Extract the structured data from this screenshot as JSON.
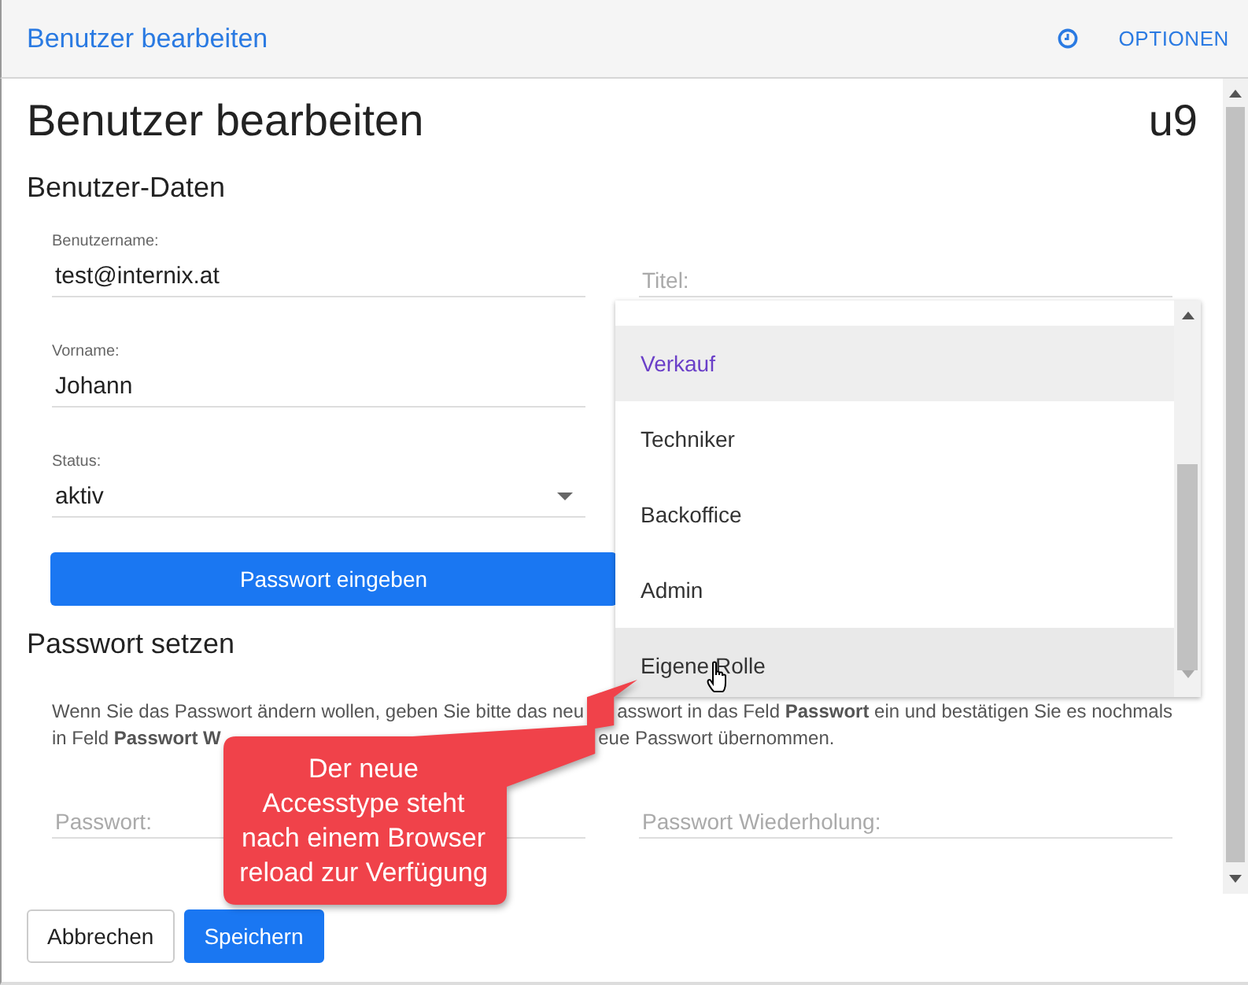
{
  "header": {
    "title": "Benutzer bearbeiten",
    "menu": "OPTIONEN"
  },
  "page": {
    "title": "Benutzer bearbeiten",
    "code": "u9"
  },
  "user_data": {
    "heading": "Benutzer-Daten",
    "left": [
      {
        "kind": "text",
        "label": "Benutzername:",
        "value": "test@internix.at"
      },
      {
        "kind": "text",
        "label": "Vorname:",
        "value": "Johann"
      },
      {
        "kind": "select",
        "label": "Status:",
        "value": "aktiv"
      }
    ],
    "right": [
      {
        "kind": "text",
        "placeholder": "Titel:"
      }
    ]
  },
  "password_button": "Passwort eingeben",
  "role_dropdown": {
    "items": [
      {
        "label": "Verkauf",
        "selected": true,
        "hovered": false
      },
      {
        "label": "Techniker",
        "selected": false,
        "hovered": false
      },
      {
        "label": "Backoffice",
        "selected": false,
        "hovered": false
      },
      {
        "label": "Admin",
        "selected": false,
        "hovered": false
      },
      {
        "label": "Eigene Rolle",
        "selected": false,
        "hovered": true
      }
    ]
  },
  "password": {
    "heading": "Passwort setzen",
    "help_lines": [
      [
        "Wenn Sie das Passwort ändern wollen, geben Sie bitte das neu",
        "asswort in das Feld **Passwort** ein und bestätigen Sie es nochmals"
      ],
      [
        "in Feld **Passwort W**",
        "eue Passwort übernommen."
      ]
    ],
    "fields": [
      {
        "placeholder": "Passwort:"
      },
      {
        "placeholder": "Passwort Wiederholung:"
      }
    ]
  },
  "callout_lines": [
    "Der neue",
    "Accesstype steht",
    "nach einem Browser",
    "reload zur Verfügung"
  ],
  "buttons": [
    {
      "label": "Abbrechen",
      "kind": "secondary"
    },
    {
      "label": "Speichern",
      "kind": "primary"
    }
  ]
}
